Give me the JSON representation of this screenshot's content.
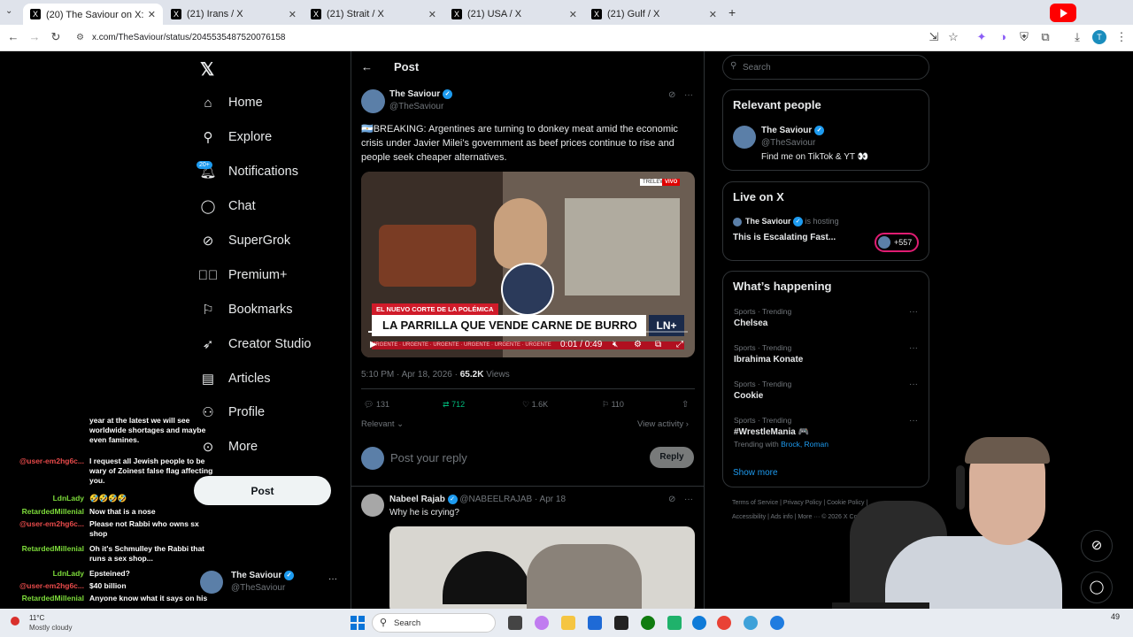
{
  "browser": {
    "tabs": [
      {
        "title": "(20) The Saviour on X: \" 🇦🇷BR",
        "active": true
      },
      {
        "title": "(21) Irans / X",
        "active": false
      },
      {
        "title": "(21) Strait / X",
        "active": false
      },
      {
        "title": "(21) USA / X",
        "active": false
      },
      {
        "title": "(21) Gulf / X",
        "active": false
      }
    ],
    "new_tab": "+",
    "url": "x.com/TheSaviour/status/2045535487520076158",
    "profile_initial": "T"
  },
  "nav": {
    "items": [
      {
        "label": "Home",
        "icon": "home-icon"
      },
      {
        "label": "Explore",
        "icon": "search-icon"
      },
      {
        "label": "Notifications",
        "icon": "bell-icon"
      },
      {
        "label": "Chat",
        "icon": "chat-icon"
      },
      {
        "label": "SuperGrok",
        "icon": "grok-icon"
      },
      {
        "label": "Premium+",
        "icon": "premium-icon"
      },
      {
        "label": "Bookmarks",
        "icon": "bookmark-icon"
      },
      {
        "label": "Creator Studio",
        "icon": "rocket-icon"
      },
      {
        "label": "Articles",
        "icon": "article-icon"
      },
      {
        "label": "Profile",
        "icon": "person-icon"
      },
      {
        "label": "More",
        "icon": "more-icon"
      }
    ],
    "notifications_badge": "20+",
    "post_button": "Post",
    "account": {
      "name": "The Saviour",
      "handle": "@TheSaviour",
      "menu": "···"
    }
  },
  "main": {
    "header": "Post",
    "tweet": {
      "name": "The Saviour",
      "handle": "@TheSaviour",
      "text": "🇦🇷BREAKING: Argentines are turning to donkey meat amid the economic crisis under Javier Milei’s government as beef prices continue to rise and people seek cheaper alternatives.",
      "video": {
        "banner_small": "EL NUEVO CORTE DE LA POLÉMICA",
        "banner_big": "LA PARRILLA QUE VENDE CARNE DE BURRO",
        "channel_tag": "TRELEW",
        "live_tag": "VIVO",
        "ticker": "URGENTE · URGENTE · URGENTE · URGENTE · URGENTE · URGENTE",
        "time": "0:01 / 0:49",
        "logo": "LN+",
        "progress": 0.02
      },
      "timestamp": "5:10 PM · Apr 18, 2026 · ",
      "views_count": "65.2K",
      "views_label": "Views",
      "stats": {
        "replies": "131",
        "reposts": "712",
        "likes": "1.6K",
        "bookmarks": "110"
      },
      "relevant": "Relevant",
      "view_activity": "View activity"
    },
    "reply_placeholder": "Post your reply",
    "reply_button": "Reply",
    "reply": {
      "name": "Nabeel Rajab",
      "handle": "@NABEELRAJAB · Apr 18",
      "text": "Why he is crying?"
    }
  },
  "sidebar": {
    "search_placeholder": "Search",
    "relevant_people": {
      "title": "Relevant people",
      "name": "The Saviour",
      "handle": "@TheSaviour",
      "bio": "Find me on TikTok & YT 👀"
    },
    "live": {
      "title": "Live on X",
      "host": "The Saviour",
      "hosting": "is hosting",
      "space_title": "This is Escalating Fast...",
      "listeners": "+557"
    },
    "happening": {
      "title": "What’s happening",
      "trends": [
        {
          "category": "Sports · Trending",
          "name": "Chelsea"
        },
        {
          "category": "Sports · Trending",
          "name": "Ibrahima Konate"
        },
        {
          "category": "Sports · Trending",
          "name": "Cookie"
        },
        {
          "category": "Sports · Trending",
          "name": "#WrestleMania 🎮",
          "with_label": "Trending with",
          "with_names": "Brock, Roman"
        }
      ],
      "show_more": "Show more"
    },
    "footer": {
      "line1": "Terms of Service  |  Privacy Policy  |  Cookie Policy  |",
      "line2": "Accessibility  |  Ads info  |  More ···  © 2026 X Corp."
    }
  },
  "chat": [
    {
      "name": "",
      "msg": "year at the latest we will see worldwide shortages and maybe even famines.",
      "color": "#ffffff"
    },
    {
      "name": "@user-em2hg6c...",
      "msg": "I request all Jewish people to be wary of Zoinest false flag affecting you.",
      "color": "#e84a4a"
    },
    {
      "name": "LdnLady",
      "msg": "🤣🤣🤣🤣",
      "color": "#7ddb3a"
    },
    {
      "name": "RetardedMillenial",
      "msg": "Now that is a nose",
      "color": "#7ddb3a"
    },
    {
      "name": "@user-em2hg6c...",
      "msg": "Please not Rabbi who owns sx shop",
      "color": "#e84a4a"
    },
    {
      "name": "RetardedMillenial",
      "msg": "Oh it's Schmulley the Rabbi that runs a sex shop...",
      "color": "#7ddb3a"
    },
    {
      "name": "LdnLady",
      "msg": "Epsteined?",
      "color": "#7ddb3a"
    },
    {
      "name": "@user-em2hg6c...",
      "msg": "$40 billion",
      "color": "#e84a4a"
    },
    {
      "name": "RetardedMillenial",
      "msg": "Anyone know what it says on his",
      "color": "#7ddb3a"
    }
  ],
  "taskbar": {
    "weather_temp": "11°C",
    "weather_desc": "Mostly cloudy",
    "search": "Search",
    "clock": "49"
  },
  "colors": {
    "accent": "#1d9bf0",
    "background": "#000000",
    "border": "#2f3336",
    "muted": "#71767b"
  }
}
